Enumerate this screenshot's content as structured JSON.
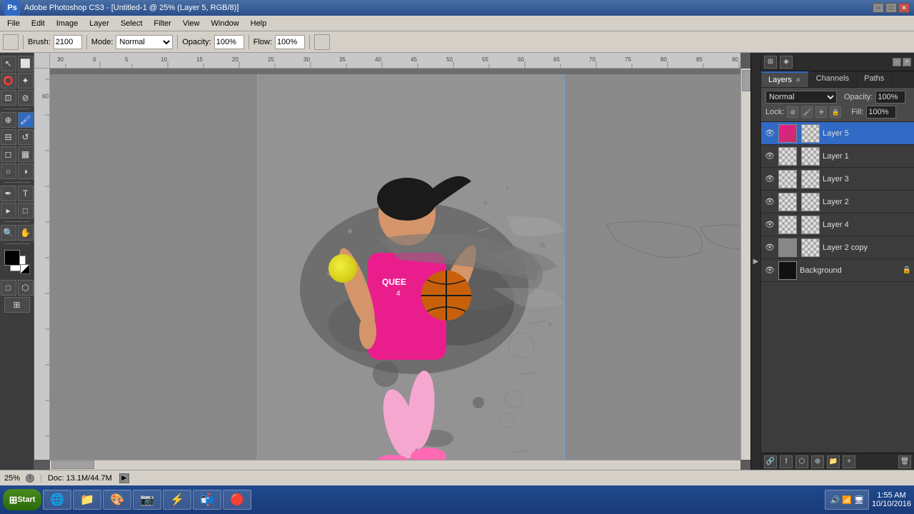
{
  "titlebar": {
    "title": "Adobe Photoshop CS3 - [Untitled-1 @ 25% (Layer 5, RGB/8)]",
    "ps_logo": "Ps",
    "controls": [
      "−",
      "□",
      "✕"
    ]
  },
  "menubar": {
    "items": [
      "File",
      "Edit",
      "Image",
      "Layer",
      "Select",
      "Filter",
      "View",
      "Window",
      "Help"
    ]
  },
  "toolbar": {
    "brush_label": "Brush:",
    "brush_size": "2100",
    "mode_label": "Mode:",
    "mode_value": "Normal",
    "opacity_label": "Opacity:",
    "opacity_value": "100%",
    "flow_label": "Flow:",
    "flow_value": "100%"
  },
  "canvas": {
    "zoom": "25%",
    "doc_info": "Doc: 13.1M/44.7M"
  },
  "layers_panel": {
    "tabs": [
      "Layers",
      "Channels",
      "Paths"
    ],
    "active_tab": "Layers",
    "blend_mode": "Normal",
    "opacity_label": "Opacity:",
    "opacity_value": "100%",
    "fill_label": "Fill:",
    "fill_value": "100%",
    "lock_label": "Lock:",
    "layers": [
      {
        "name": "Layer 5",
        "visible": true,
        "active": true,
        "thumb": "pink",
        "locked": false
      },
      {
        "name": "Layer 1",
        "visible": true,
        "active": false,
        "thumb": "transparent",
        "locked": false
      },
      {
        "name": "Layer 3",
        "visible": true,
        "active": false,
        "thumb": "transparent",
        "locked": false
      },
      {
        "name": "Layer 2",
        "visible": true,
        "active": false,
        "thumb": "transparent",
        "locked": false
      },
      {
        "name": "Layer 4",
        "visible": true,
        "active": false,
        "thumb": "transparent",
        "locked": false
      },
      {
        "name": "Layer 2 copy",
        "visible": true,
        "active": false,
        "thumb": "grey",
        "locked": false
      },
      {
        "name": "Background",
        "visible": true,
        "active": false,
        "thumb": "black",
        "locked": true
      }
    ]
  },
  "statusbar": {
    "zoom": "25%",
    "doc_info": "Doc: 13.1M/44.7M"
  },
  "taskbar": {
    "start_label": "Start",
    "apps": [
      "🌐",
      "📁",
      "🎨",
      "📷",
      "⚡",
      "📬",
      "🔴"
    ],
    "clock": "1:55 AM",
    "date": "10/10/2016"
  },
  "tools": {
    "items": [
      "↖",
      "✏",
      "🖊",
      "🖌",
      "🔍",
      "⬜",
      "⭕",
      "✂",
      "🖊",
      "T",
      "🔲",
      "🪣",
      "⬚",
      "🔳",
      "🔳"
    ]
  }
}
